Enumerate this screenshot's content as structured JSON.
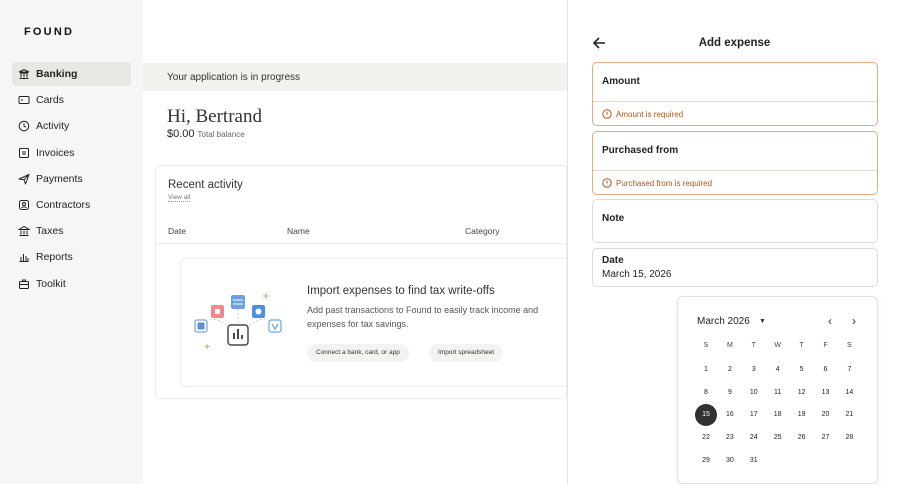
{
  "brand": "FOUND",
  "nav": [
    {
      "label": "Banking",
      "icon": "bank-icon",
      "active": true
    },
    {
      "label": "Cards",
      "icon": "card-icon"
    },
    {
      "label": "Activity",
      "icon": "clock-icon"
    },
    {
      "label": "Invoices",
      "icon": "invoice-icon"
    },
    {
      "label": "Payments",
      "icon": "send-icon"
    },
    {
      "label": "Contractors",
      "icon": "contractor-icon"
    },
    {
      "label": "Taxes",
      "icon": "bank-building-icon"
    },
    {
      "label": "Reports",
      "icon": "bar-chart-icon"
    },
    {
      "label": "Toolkit",
      "icon": "toolbox-icon"
    }
  ],
  "main": {
    "banner": "Your application is in progress",
    "greeting": "Hi, Bertrand",
    "balance": "$0.00",
    "balance_label": "Total balance",
    "activity": {
      "title": "Recent activity",
      "view_all": "View all",
      "columns": [
        "Date",
        "Name",
        "Category"
      ]
    },
    "empty_state": {
      "title": "Import expenses to find tax write-offs",
      "description": "Add past transactions to Found to easily track income and expenses for tax savings.",
      "connect_label": "Connect a bank, card, or app",
      "import_label": "Import spreadsheet"
    }
  },
  "panel": {
    "title": "Add expense",
    "amount_label": "Amount",
    "amount_error": "Amount is required",
    "purchased_label": "Purchased from",
    "purchased_error": "Purchased from is required",
    "note_label": "Note",
    "date_label": "Date",
    "date_value": "March 15, 2026"
  },
  "calendar": {
    "month_label": "March 2026",
    "weekdays": [
      "S",
      "M",
      "T",
      "W",
      "T",
      "F",
      "S"
    ],
    "first_weekday": 0,
    "days_in_month": 31,
    "selected_day": 15
  },
  "colors": {
    "error_text": "#b0561c",
    "error_border": "#e3ab83",
    "selected_day": "#2f3133"
  }
}
